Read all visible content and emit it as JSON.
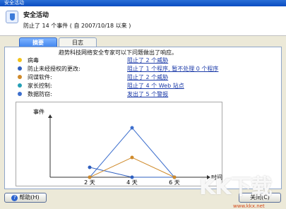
{
  "window": {
    "title": "安全活动"
  },
  "header": {
    "title": "安全活动",
    "subtitle": "防止了 14 个事件 ( 自 2007/10/18 以来 )"
  },
  "tabs": [
    {
      "label": "摘要",
      "active": true
    },
    {
      "label": "日志",
      "active": false
    }
  ],
  "panel": {
    "intro": "趋势科技网络安全专家可以下问题做出了响应。",
    "rows": [
      {
        "label": "病毒",
        "link": "阻止了 2 个威胁",
        "color": "#f2c31a"
      },
      {
        "label": "防止未经授权的更改:",
        "link": "阻止了 1 个程序, 暂不处理 0 个程序",
        "color": "#2f5fbf"
      },
      {
        "label": "间谍软件:",
        "link": "阻止了 2 个威胁",
        "color": "#cf8a2a"
      },
      {
        "label": "家长控制:",
        "link": "阻止了 4 个 Web 站点",
        "color": "#25a0b6"
      },
      {
        "label": "数据防窃:",
        "link": "发出了 5 个警报",
        "color": "#3d6fcd"
      }
    ]
  },
  "chart_data": {
    "type": "line",
    "title": "",
    "ylabel": "事件",
    "xlabel": "时间",
    "x": [
      "2 天",
      "4 天",
      "6 天"
    ],
    "ylim": [
      0,
      5
    ],
    "grid": false,
    "series": [
      {
        "values": [
          0,
          5,
          0
        ],
        "color": "#3d6fcd"
      },
      {
        "values": [
          1,
          0,
          0
        ],
        "color": "#2f5fbf"
      },
      {
        "values": [
          0,
          2,
          0
        ],
        "color": "#cf8a2a"
      }
    ]
  },
  "buttons": {
    "help": "帮助(H)",
    "close": "关闭(C)"
  },
  "watermark": {
    "text": "KK下载",
    "url": "www.kkx.net"
  }
}
